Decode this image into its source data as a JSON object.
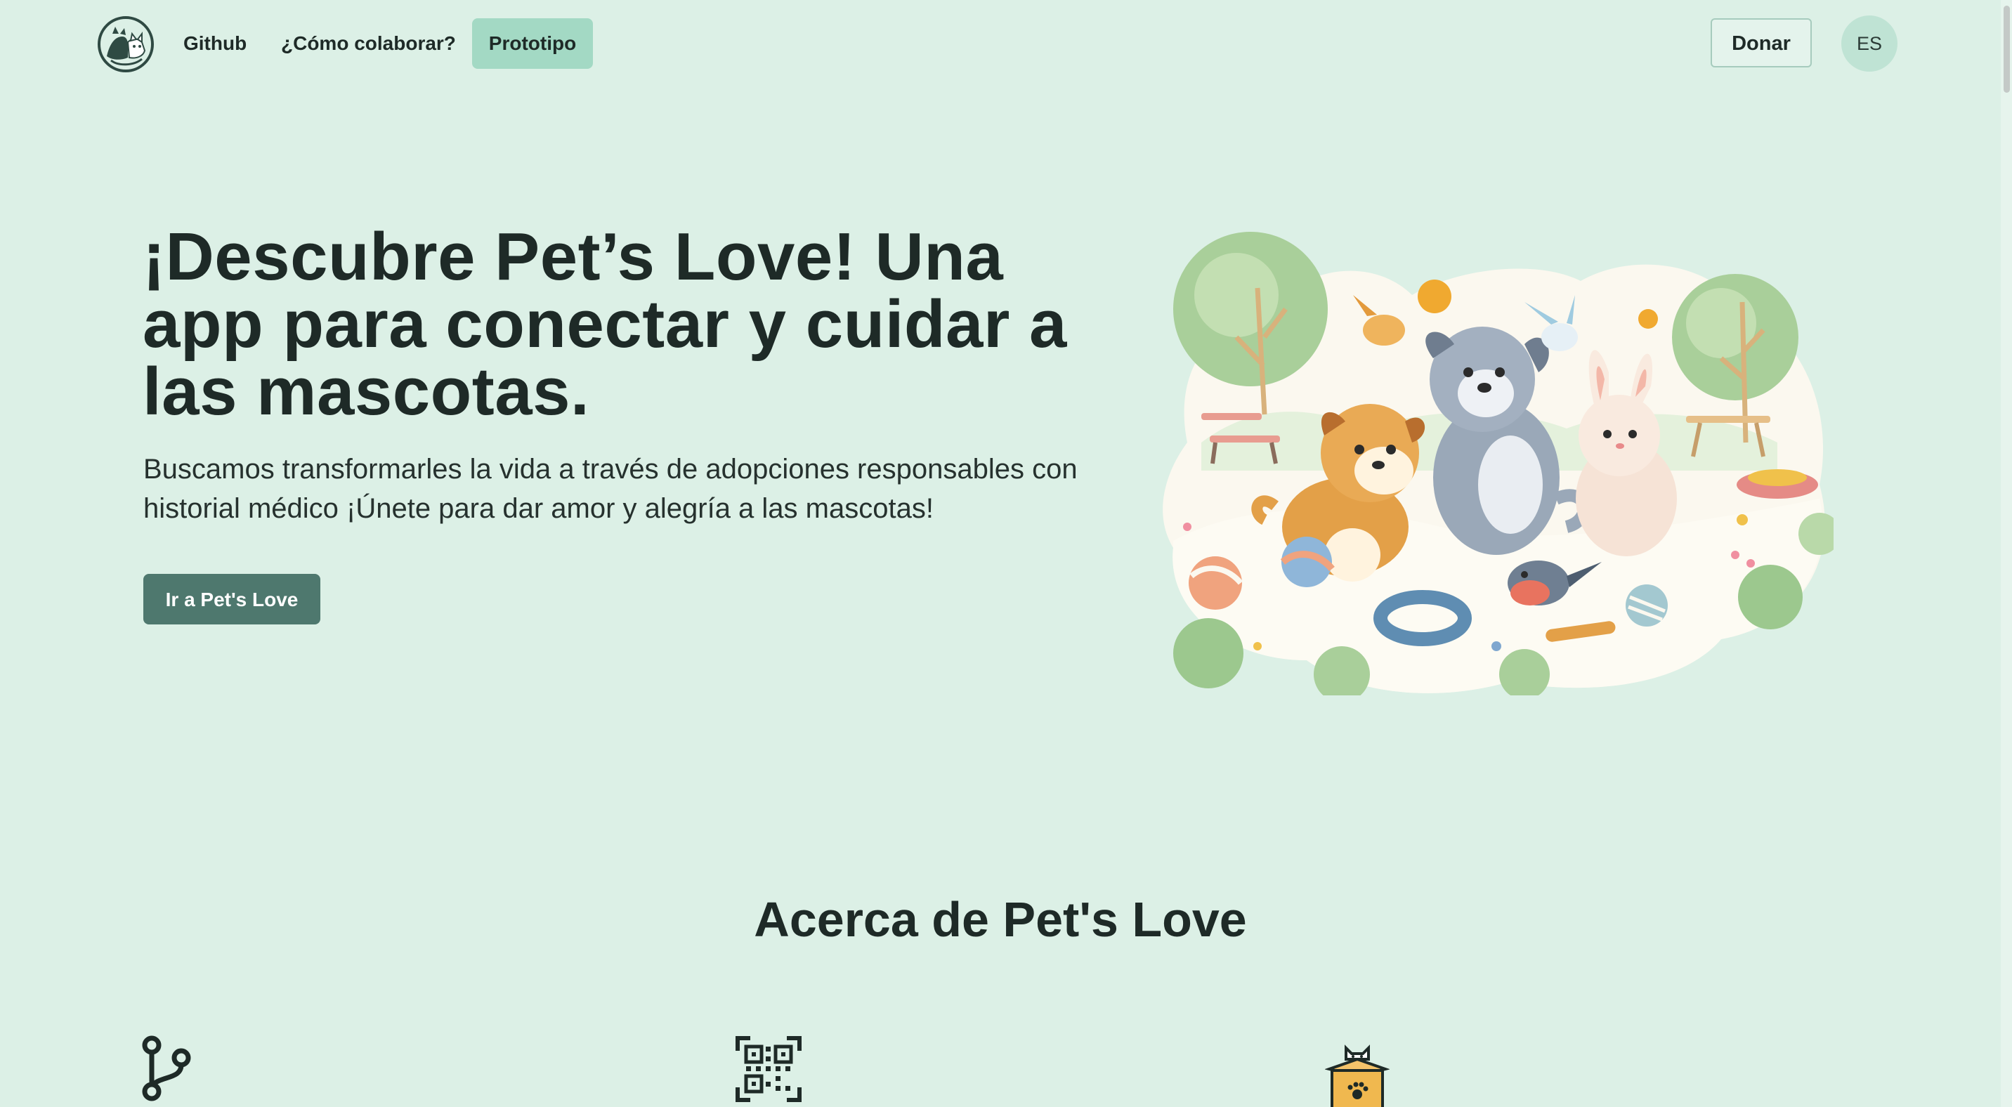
{
  "nav": {
    "logo_icon": "pets-logo-icon",
    "github_label": "Github",
    "colaborar_label": "¿Cómo colaborar?",
    "prototipo_label": "Prototipo",
    "donar_label": "Donar",
    "language_label": "ES"
  },
  "hero": {
    "title": "¡Descubre Pet’s Love! Una app para conectar y cuidar a las mascotas.",
    "subtitle": "Buscamos transformarles la vida a través de adopciones responsables con historial médico ¡Únete para dar amor y alegría a las mascotas!",
    "cta_label": "Ir a Pet's Love",
    "illustration": "pets-in-park-illustration"
  },
  "about": {
    "title": "Acerca de Pet's Love",
    "feature_icons": [
      "git-branch-icon",
      "qr-code-icon",
      "cat-in-box-icon"
    ]
  },
  "colors": {
    "background": "#dcf0e6",
    "accent_active_tab": "#a3d9c4",
    "primary_button": "#4e786e",
    "text": "#1e2a27"
  }
}
